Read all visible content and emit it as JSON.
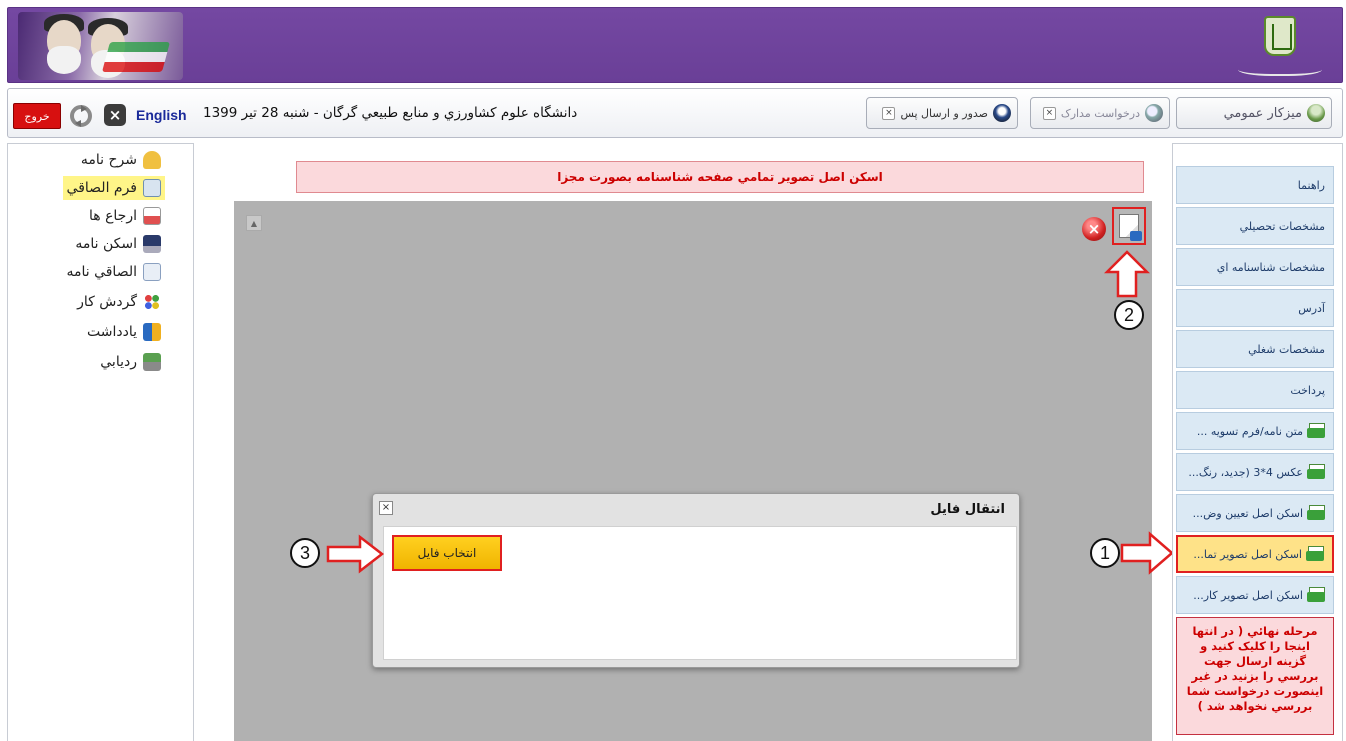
{
  "toolbar": {
    "exit_label": "خروج",
    "english_label": "English",
    "date_text": "دانشگاه علوم کشاورزي و منابع طبيعي گرگان - شنبه 28 تير 1399",
    "tabs": {
      "dashboard": "ميزکار عمومي",
      "docs": "درخواست مدارک",
      "issue": "صدور و ارسال پس"
    }
  },
  "left_menu": {
    "items": [
      {
        "label": "شرح نامه"
      },
      {
        "label": "فرم الصاقي"
      },
      {
        "label": "ارجاع ها"
      },
      {
        "label": "اسکن نامه"
      },
      {
        "label": "الصاقي نامه"
      },
      {
        "label": "گردش کار"
      },
      {
        "label": "يادداشت"
      },
      {
        "label": "رديابي"
      }
    ]
  },
  "main": {
    "notice": "اسکن اصل تصوير تمامي صفحه شناسنامه بصورت مجزا",
    "dialog": {
      "title": "انتقال فايل",
      "close": "×",
      "choose_file": "انتخاب فايل"
    }
  },
  "right_sidebar": {
    "items": [
      {
        "label": "راهنما"
      },
      {
        "label": "مشخصات تحصيلي"
      },
      {
        "label": "مشخصات شناسنامه اي"
      },
      {
        "label": "آدرس"
      },
      {
        "label": "مشخصات شغلي"
      },
      {
        "label": "پرداخت"
      },
      {
        "label": "متن نامه/فرم تسويه ..."
      },
      {
        "label": "عکس 4*3 (جديد، رنگ..."
      },
      {
        "label": "اسکن اصل تعيين وض..."
      },
      {
        "label": "اسکن اصل تصوير تما..."
      },
      {
        "label": "اسکن اصل تصوير کار..."
      }
    ],
    "final_notice": "مرحله نهائي ( در انتها اينجا را کليک کنيد و گزينه ارسال جهت بررسي را بزنيد در غير اينصورت درخواست شما بررسي نخواهد شد )"
  },
  "annotations": {
    "step1": "1",
    "step2": "2",
    "step3": "3"
  },
  "colors": {
    "banner": "#6a3f97",
    "highlight_red": "#e02020",
    "button_yellow": "#f0b400",
    "sidebar_blue": "#dbe9f4"
  }
}
